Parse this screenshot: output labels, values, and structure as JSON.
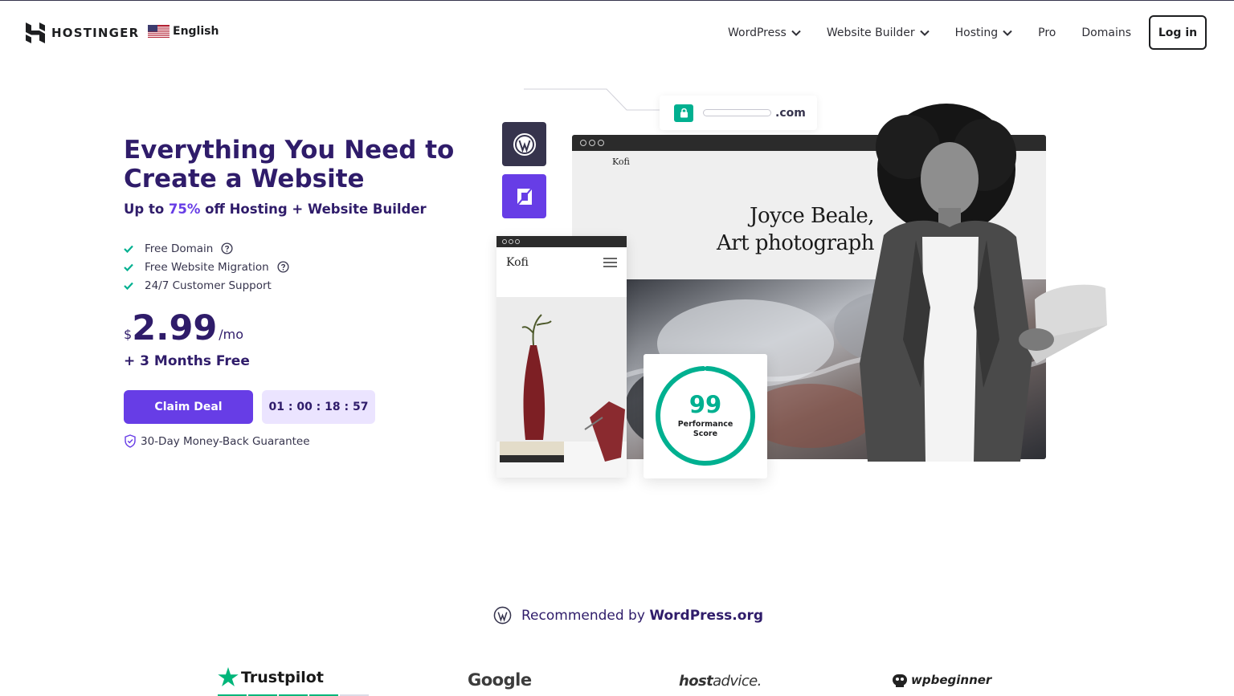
{
  "header": {
    "brand": "HOSTINGER",
    "language": "English",
    "nav": [
      {
        "label": "WordPress",
        "has_dropdown": true
      },
      {
        "label": "Website Builder",
        "has_dropdown": true
      },
      {
        "label": "Hosting",
        "has_dropdown": true
      },
      {
        "label": "Pro",
        "has_dropdown": false
      },
      {
        "label": "Domains",
        "has_dropdown": false
      }
    ],
    "login_label": "Log in"
  },
  "hero": {
    "title": "Everything You Need to Create a Website",
    "subtitle_prefix": "Up to ",
    "subtitle_discount": "75%",
    "subtitle_suffix": " off Hosting + Website Builder",
    "features": [
      "Free Domain",
      "Free Website Migration",
      "24/7 Customer Support"
    ],
    "price_currency": "$",
    "price_amount": "2.99",
    "price_period": "/mo",
    "bonus": "+ 3 Months Free",
    "cta_label": "Claim Deal",
    "countdown": "01 : 00 : 18 : 57",
    "guarantee": "30-Day Money-Back Guarantee"
  },
  "illustration": {
    "url_tld": ".com",
    "site_brand": "Kofi",
    "mobile_brand": "Kofi",
    "headline_line1": "Joyce Beale,",
    "headline_line2": "Art photograph",
    "performance_score": "99",
    "performance_label_1": "Performance",
    "performance_label_2": "Score"
  },
  "recommended": {
    "prefix": "Recommended by ",
    "source": "WordPress.org"
  },
  "reviews": {
    "trustpilot": "Trustpilot",
    "google": "Google",
    "hostadvice_bold": "host",
    "hostadvice_rest": "advice.",
    "wpbeginner": "wpbeginner"
  },
  "colors": {
    "brand_purple": "#673de6",
    "deep_navy": "#2f1c6a",
    "success_green": "#00b090",
    "timer_bg": "#ebe4ff"
  }
}
